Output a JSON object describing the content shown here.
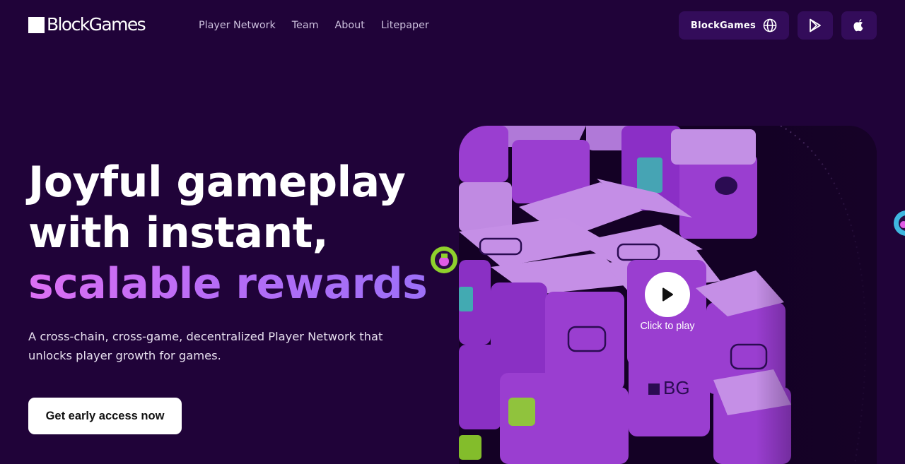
{
  "brand": {
    "logo_text": "BlockGames"
  },
  "nav": {
    "items": [
      {
        "label": "Player Network"
      },
      {
        "label": "Team"
      },
      {
        "label": "About"
      },
      {
        "label": "Litepaper"
      }
    ]
  },
  "header_actions": {
    "network_label": "BlockGames",
    "network_icon": "globe-icon",
    "google_play_icon": "google-play-icon",
    "apple_icon": "apple-icon"
  },
  "hero": {
    "title_line1": "Joyful gameplay",
    "title_line2": "with instant,",
    "title_accent": "scalable rewards",
    "subtitle": "A cross-chain, cross-game, decentralized Player Network that unlocks player growth for games.",
    "cta_label": "Get early access now"
  },
  "video": {
    "play_label": "Click to play",
    "cube_logo_text": "BG"
  },
  "colors": {
    "background": "#200339",
    "pill_background": "#330c5a",
    "accent_gradient_start": "#dc70f4",
    "accent_gradient_end": "#9a70f8",
    "cube_purple": "#9a3ed0"
  }
}
